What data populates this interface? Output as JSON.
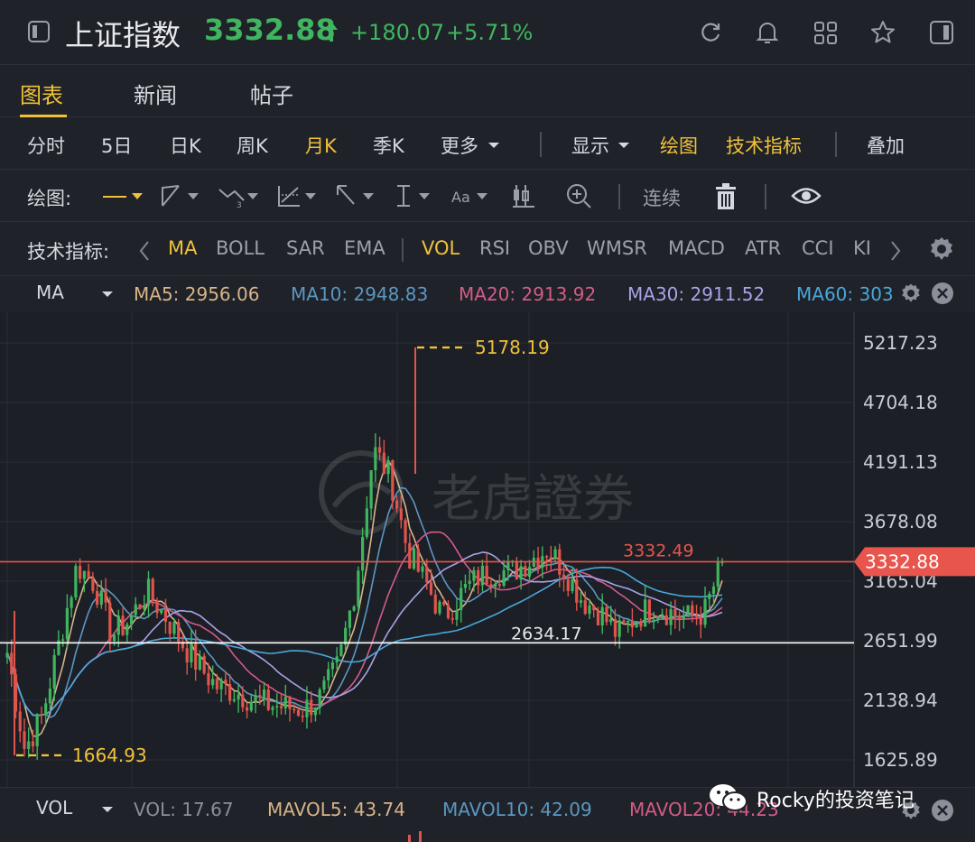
{
  "header": {
    "title": "上证指数",
    "price": "3332.88",
    "change": "+180.07",
    "change_pct": "+5.71%"
  },
  "tabs": [
    {
      "label": "图表",
      "active": true
    },
    {
      "label": "新闻",
      "active": false
    },
    {
      "label": "帖子",
      "active": false
    }
  ],
  "periods": {
    "items": [
      {
        "label": "分时",
        "active": false
      },
      {
        "label": "5日",
        "active": false
      },
      {
        "label": "日K",
        "active": false
      },
      {
        "label": "周K",
        "active": false
      },
      {
        "label": "月K",
        "active": true
      },
      {
        "label": "季K",
        "active": false
      },
      {
        "label": "更多",
        "active": false
      }
    ],
    "display": "显示",
    "draw": "绘图",
    "indicators": "技术指标",
    "overlay": "叠加"
  },
  "draw_toolbar": {
    "label": "绘图:",
    "continuous": "连续"
  },
  "indicator_bar": {
    "label": "技术指标:",
    "items": [
      {
        "label": "MA",
        "active": true
      },
      {
        "label": "BOLL",
        "active": false
      },
      {
        "label": "SAR",
        "active": false
      },
      {
        "label": "EMA",
        "active": false
      },
      {
        "label": "VOL",
        "active": true
      },
      {
        "label": "RSI",
        "active": false
      },
      {
        "label": "OBV",
        "active": false
      },
      {
        "label": "WMSR",
        "active": false
      },
      {
        "label": "MACD",
        "active": false
      },
      {
        "label": "ATR",
        "active": false
      },
      {
        "label": "CCI",
        "active": false
      },
      {
        "label": "KI",
        "active": false
      }
    ]
  },
  "ma_legend": {
    "selector": "MA",
    "items": [
      {
        "label": "MA5: 2956.06",
        "color": "#d8b48a"
      },
      {
        "label": "MA10: 2948.83",
        "color": "#5b97c2"
      },
      {
        "label": "MA20: 2913.92",
        "color": "#d35b8b"
      },
      {
        "label": "MA30: 2911.52",
        "color": "#a9a2e8"
      },
      {
        "label": "MA60: 303",
        "color": "#4aa7db"
      }
    ]
  },
  "vol_legend": {
    "selector": "VOL",
    "items": [
      {
        "label": "VOL: 17.67",
        "color": "#8a8f99"
      },
      {
        "label": "MAVOL5: 43.74",
        "color": "#d8b48a"
      },
      {
        "label": "MAVOL10: 42.09",
        "color": "#5b97c2"
      },
      {
        "label": "MAVOL20: 44.23",
        "color": "#d35b8b"
      }
    ]
  },
  "watermark": "老虎證券",
  "footer_badge": "Rocky的投资笔记",
  "colors": {
    "up": "#3fb55f",
    "down": "#e0544c",
    "accent": "#f0c13a",
    "current_price": "#e8554d",
    "support_line": "#ffffff"
  },
  "chart_data": {
    "type": "candlestick",
    "y_axis_ticks": [
      "5217.23",
      "4704.18",
      "4191.13",
      "3678.08",
      "3165.04",
      "2651.99",
      "2138.94",
      "1625.89"
    ],
    "ylim": [
      1625.89,
      5217.23
    ],
    "current_price": {
      "value": 3332.88,
      "label": "3332.88"
    },
    "reference_lines": [
      {
        "value": 3332.49,
        "label": "3332.49"
      },
      {
        "value": 2634.17,
        "label": "2634.17"
      }
    ],
    "annotations": [
      {
        "label": "5178.19",
        "value": 5178.19,
        "kind": "high"
      },
      {
        "label": "1664.93",
        "value": 1664.93,
        "kind": "low"
      }
    ],
    "close_series": [
      2550,
      1720,
      2000,
      2650,
      3300,
      3150,
      2700,
      2830,
      3080,
      2880,
      2640,
      2430,
      2260,
      2220,
      2150,
      2100,
      2080,
      2060,
      2170,
      2450,
      3150,
      4300,
      4050,
      3400,
      3150,
      2850,
      3050,
      3200,
      3250,
      3250,
      3350,
      3450,
      3250,
      3000,
      2900,
      2700,
      2850,
      2950,
      2900,
      2850,
      2900,
      3332.88
    ]
  }
}
